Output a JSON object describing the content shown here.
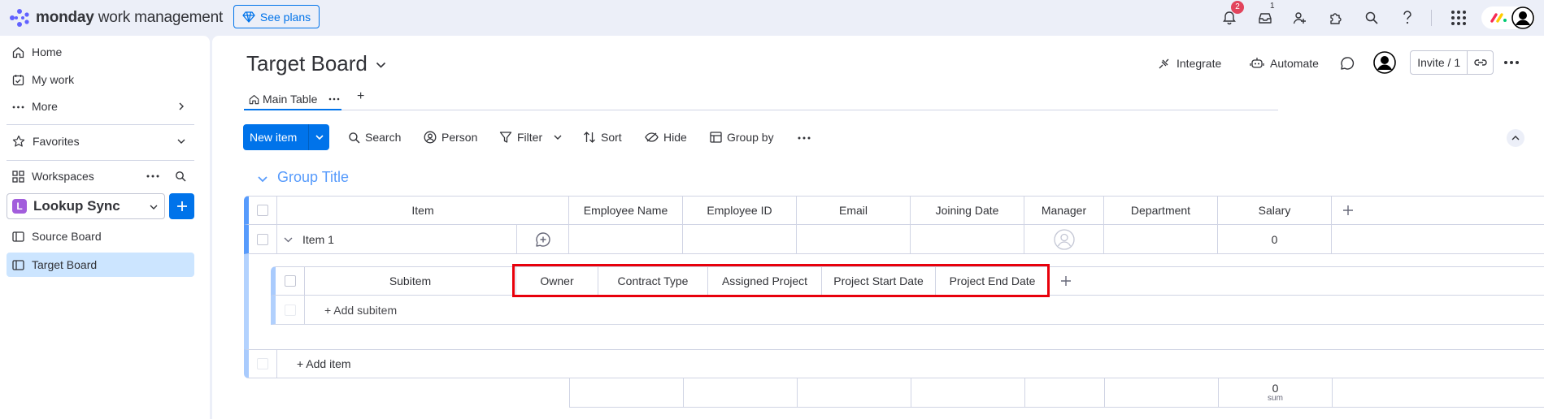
{
  "topbar": {
    "logo_bold": "monday",
    "logo_rest": " work management",
    "see_plans": "See plans",
    "notifications_count": "2",
    "inbox_count": "1"
  },
  "sidebar": {
    "nav": [
      {
        "label": "Home",
        "icon": "home-icon"
      },
      {
        "label": "My work",
        "icon": "calendar-check-icon"
      },
      {
        "label": "More",
        "icon": "more-dots-icon"
      }
    ],
    "favorites": "Favorites",
    "workspaces": "Workspaces",
    "workspace_letter": "L",
    "workspace_name": "Lookup Sync",
    "boards": [
      {
        "label": "Source Board",
        "selected": false
      },
      {
        "label": "Target Board",
        "selected": true
      }
    ]
  },
  "board": {
    "title": "Target Board",
    "integrate": "Integrate",
    "automate": "Automate",
    "invite": "Invite / 1",
    "tab_main": "Main Table",
    "tab_add": "+",
    "new_item": "New item",
    "tools": [
      "Search",
      "Person",
      "Filter",
      "Sort",
      "Hide",
      "Group by"
    ],
    "group_title": "Group Title"
  },
  "main_table": {
    "columns": [
      "Item",
      "Employee Name",
      "Employee ID",
      "Email",
      "Joining Date",
      "Manager",
      "Department",
      "Salary"
    ],
    "rows": [
      {
        "item": "Item 1",
        "salary": "0"
      }
    ],
    "add_item": "+ Add item",
    "footer_salary": "0",
    "footer_label": "sum"
  },
  "subitems_table": {
    "columns": [
      "Subitem",
      "Owner",
      "Contract Type",
      "Assigned Project",
      "Project Start Date",
      "Project End Date"
    ],
    "add_subitem": "+ Add subitem"
  },
  "colors": {
    "accent": "#0073ea",
    "group": "#579bfc",
    "highlight": "#e8000b",
    "badge": "#e2445c"
  }
}
